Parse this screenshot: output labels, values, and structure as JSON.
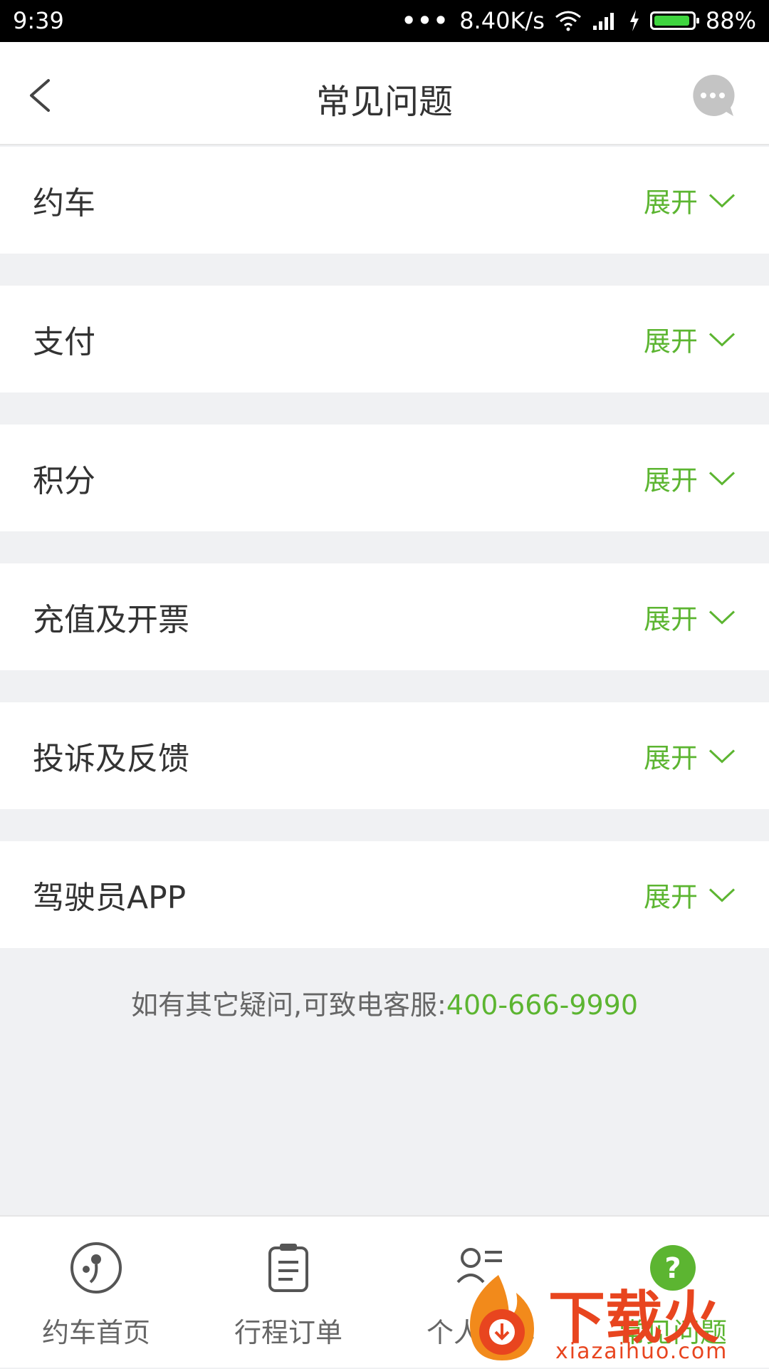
{
  "status_bar": {
    "time": "9:39",
    "net_speed": "8.40K/s",
    "battery": "88%"
  },
  "header": {
    "title": "常见问题"
  },
  "faq": [
    {
      "label": "约车",
      "action": "展开"
    },
    {
      "label": "支付",
      "action": "展开"
    },
    {
      "label": "积分",
      "action": "展开"
    },
    {
      "label": "充值及开票",
      "action": "展开"
    },
    {
      "label": "投诉及反馈",
      "action": "展开"
    },
    {
      "label": "驾驶员APP",
      "action": "展开"
    }
  ],
  "contact": {
    "text": "如有其它疑问,可致电客服:",
    "phone": "400-666-9990"
  },
  "tabs": [
    {
      "label": "约车首页",
      "icon": "car-home-icon"
    },
    {
      "label": "行程订单",
      "icon": "clipboard-icon"
    },
    {
      "label": "个人中心",
      "icon": "profile-list-icon"
    },
    {
      "label": "常见问题",
      "icon": "question-icon"
    }
  ],
  "watermark": {
    "brand": "下载火",
    "url": "xiazaihuo.com"
  },
  "colors": {
    "accent": "#5cb531",
    "background": "#f0f1f3"
  }
}
